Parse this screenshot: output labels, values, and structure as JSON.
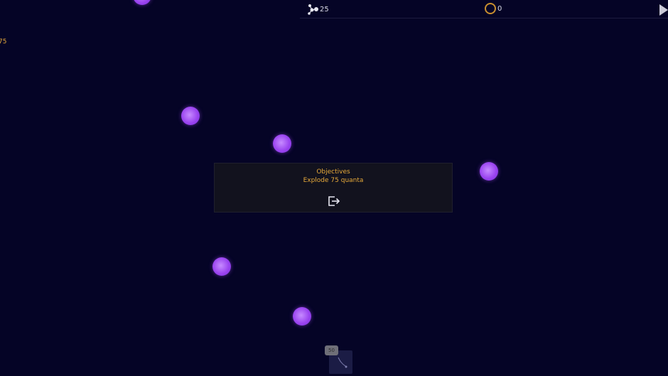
{
  "hud": {
    "particles_icon": "molecule-icon",
    "particles_value": "25",
    "coins_icon": "coin-ring-icon",
    "coins_value": "0",
    "play_icon": "play-icon"
  },
  "left_counter": "75",
  "objectives": {
    "title": "Objectives",
    "text": "Explode 75 quanta",
    "exit_icon": "exit-icon"
  },
  "bottom_widget": {
    "badge": "50",
    "icon": "curve-icon"
  },
  "colors": {
    "background": "#050426",
    "accent": "#e6a93a",
    "orb": "#9b45f0",
    "panel": "#12121e"
  }
}
